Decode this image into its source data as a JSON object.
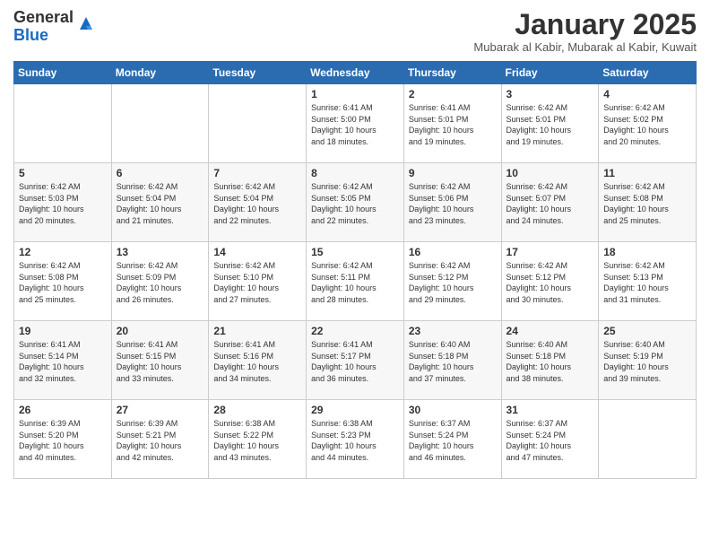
{
  "logo": {
    "general": "General",
    "blue": "Blue"
  },
  "title": "January 2025",
  "subtitle": "Mubarak al Kabir, Mubarak al Kabir, Kuwait",
  "weekdays": [
    "Sunday",
    "Monday",
    "Tuesday",
    "Wednesday",
    "Thursday",
    "Friday",
    "Saturday"
  ],
  "weeks": [
    [
      {
        "day": "",
        "info": ""
      },
      {
        "day": "",
        "info": ""
      },
      {
        "day": "",
        "info": ""
      },
      {
        "day": "1",
        "info": "Sunrise: 6:41 AM\nSunset: 5:00 PM\nDaylight: 10 hours\nand 18 minutes."
      },
      {
        "day": "2",
        "info": "Sunrise: 6:41 AM\nSunset: 5:01 PM\nDaylight: 10 hours\nand 19 minutes."
      },
      {
        "day": "3",
        "info": "Sunrise: 6:42 AM\nSunset: 5:01 PM\nDaylight: 10 hours\nand 19 minutes."
      },
      {
        "day": "4",
        "info": "Sunrise: 6:42 AM\nSunset: 5:02 PM\nDaylight: 10 hours\nand 20 minutes."
      }
    ],
    [
      {
        "day": "5",
        "info": "Sunrise: 6:42 AM\nSunset: 5:03 PM\nDaylight: 10 hours\nand 20 minutes."
      },
      {
        "day": "6",
        "info": "Sunrise: 6:42 AM\nSunset: 5:04 PM\nDaylight: 10 hours\nand 21 minutes."
      },
      {
        "day": "7",
        "info": "Sunrise: 6:42 AM\nSunset: 5:04 PM\nDaylight: 10 hours\nand 22 minutes."
      },
      {
        "day": "8",
        "info": "Sunrise: 6:42 AM\nSunset: 5:05 PM\nDaylight: 10 hours\nand 22 minutes."
      },
      {
        "day": "9",
        "info": "Sunrise: 6:42 AM\nSunset: 5:06 PM\nDaylight: 10 hours\nand 23 minutes."
      },
      {
        "day": "10",
        "info": "Sunrise: 6:42 AM\nSunset: 5:07 PM\nDaylight: 10 hours\nand 24 minutes."
      },
      {
        "day": "11",
        "info": "Sunrise: 6:42 AM\nSunset: 5:08 PM\nDaylight: 10 hours\nand 25 minutes."
      }
    ],
    [
      {
        "day": "12",
        "info": "Sunrise: 6:42 AM\nSunset: 5:08 PM\nDaylight: 10 hours\nand 25 minutes."
      },
      {
        "day": "13",
        "info": "Sunrise: 6:42 AM\nSunset: 5:09 PM\nDaylight: 10 hours\nand 26 minutes."
      },
      {
        "day": "14",
        "info": "Sunrise: 6:42 AM\nSunset: 5:10 PM\nDaylight: 10 hours\nand 27 minutes."
      },
      {
        "day": "15",
        "info": "Sunrise: 6:42 AM\nSunset: 5:11 PM\nDaylight: 10 hours\nand 28 minutes."
      },
      {
        "day": "16",
        "info": "Sunrise: 6:42 AM\nSunset: 5:12 PM\nDaylight: 10 hours\nand 29 minutes."
      },
      {
        "day": "17",
        "info": "Sunrise: 6:42 AM\nSunset: 5:12 PM\nDaylight: 10 hours\nand 30 minutes."
      },
      {
        "day": "18",
        "info": "Sunrise: 6:42 AM\nSunset: 5:13 PM\nDaylight: 10 hours\nand 31 minutes."
      }
    ],
    [
      {
        "day": "19",
        "info": "Sunrise: 6:41 AM\nSunset: 5:14 PM\nDaylight: 10 hours\nand 32 minutes."
      },
      {
        "day": "20",
        "info": "Sunrise: 6:41 AM\nSunset: 5:15 PM\nDaylight: 10 hours\nand 33 minutes."
      },
      {
        "day": "21",
        "info": "Sunrise: 6:41 AM\nSunset: 5:16 PM\nDaylight: 10 hours\nand 34 minutes."
      },
      {
        "day": "22",
        "info": "Sunrise: 6:41 AM\nSunset: 5:17 PM\nDaylight: 10 hours\nand 36 minutes."
      },
      {
        "day": "23",
        "info": "Sunrise: 6:40 AM\nSunset: 5:18 PM\nDaylight: 10 hours\nand 37 minutes."
      },
      {
        "day": "24",
        "info": "Sunrise: 6:40 AM\nSunset: 5:18 PM\nDaylight: 10 hours\nand 38 minutes."
      },
      {
        "day": "25",
        "info": "Sunrise: 6:40 AM\nSunset: 5:19 PM\nDaylight: 10 hours\nand 39 minutes."
      }
    ],
    [
      {
        "day": "26",
        "info": "Sunrise: 6:39 AM\nSunset: 5:20 PM\nDaylight: 10 hours\nand 40 minutes."
      },
      {
        "day": "27",
        "info": "Sunrise: 6:39 AM\nSunset: 5:21 PM\nDaylight: 10 hours\nand 42 minutes."
      },
      {
        "day": "28",
        "info": "Sunrise: 6:38 AM\nSunset: 5:22 PM\nDaylight: 10 hours\nand 43 minutes."
      },
      {
        "day": "29",
        "info": "Sunrise: 6:38 AM\nSunset: 5:23 PM\nDaylight: 10 hours\nand 44 minutes."
      },
      {
        "day": "30",
        "info": "Sunrise: 6:37 AM\nSunset: 5:24 PM\nDaylight: 10 hours\nand 46 minutes."
      },
      {
        "day": "31",
        "info": "Sunrise: 6:37 AM\nSunset: 5:24 PM\nDaylight: 10 hours\nand 47 minutes."
      },
      {
        "day": "",
        "info": ""
      }
    ]
  ]
}
